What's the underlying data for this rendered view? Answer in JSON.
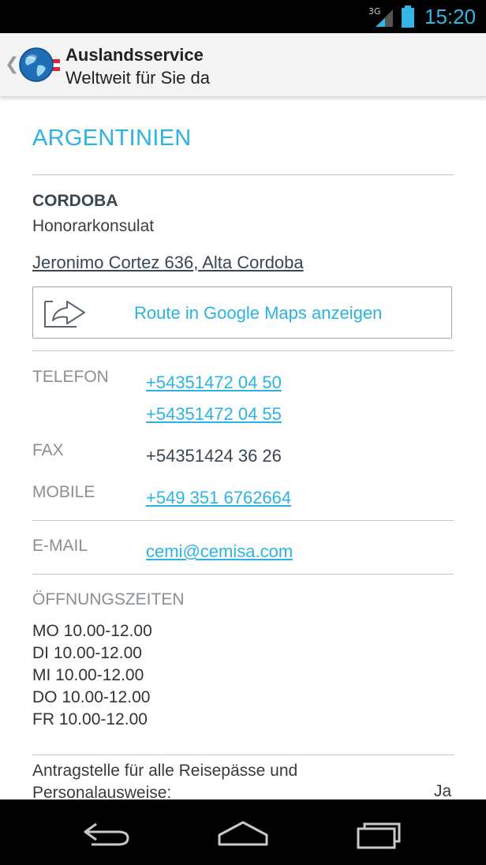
{
  "statusbar": {
    "network": "3G",
    "time": "15:20"
  },
  "actionbar": {
    "title": "Auslandsservice",
    "subtitle": "Weltweit für Sie da"
  },
  "consulate": {
    "country": "ARGENTINIEN",
    "city": "CORDOBA",
    "type": "Honorarkonsulat",
    "address": "Jeronimo Cortez 636, Alta Cordoba",
    "route_button": "Route in Google Maps anzeigen"
  },
  "contact": {
    "telefon_label": "TELEFON",
    "telefon": [
      "+54351472 04 50",
      "+54351472 04 55"
    ],
    "fax_label": "FAX",
    "fax": "+54351424 36 26",
    "mobile_label": "MOBILE",
    "mobile": "+549 351 6762664",
    "email_label": "E-MAIL",
    "email": "cemi@cemisa.com"
  },
  "hours": {
    "label": "ÖFFNUNGSZEITEN",
    "lines": [
      "MO 10.00-12.00",
      "DI 10.00-12.00",
      "MI 10.00-12.00",
      "DO 10.00-12.00",
      "FR 10.00-12.00"
    ]
  },
  "passport": {
    "line1": "Antragstelle für alle Reisepässe und",
    "line2": "Personalausweise:",
    "value": "Ja"
  },
  "colors": {
    "accent": "#2bb3e4",
    "statusbar": "#000000",
    "text": "#3a4653"
  },
  "icons": {
    "back": "chevron-left-icon",
    "logo": "globe-icon",
    "route": "route-arrow-icon"
  }
}
